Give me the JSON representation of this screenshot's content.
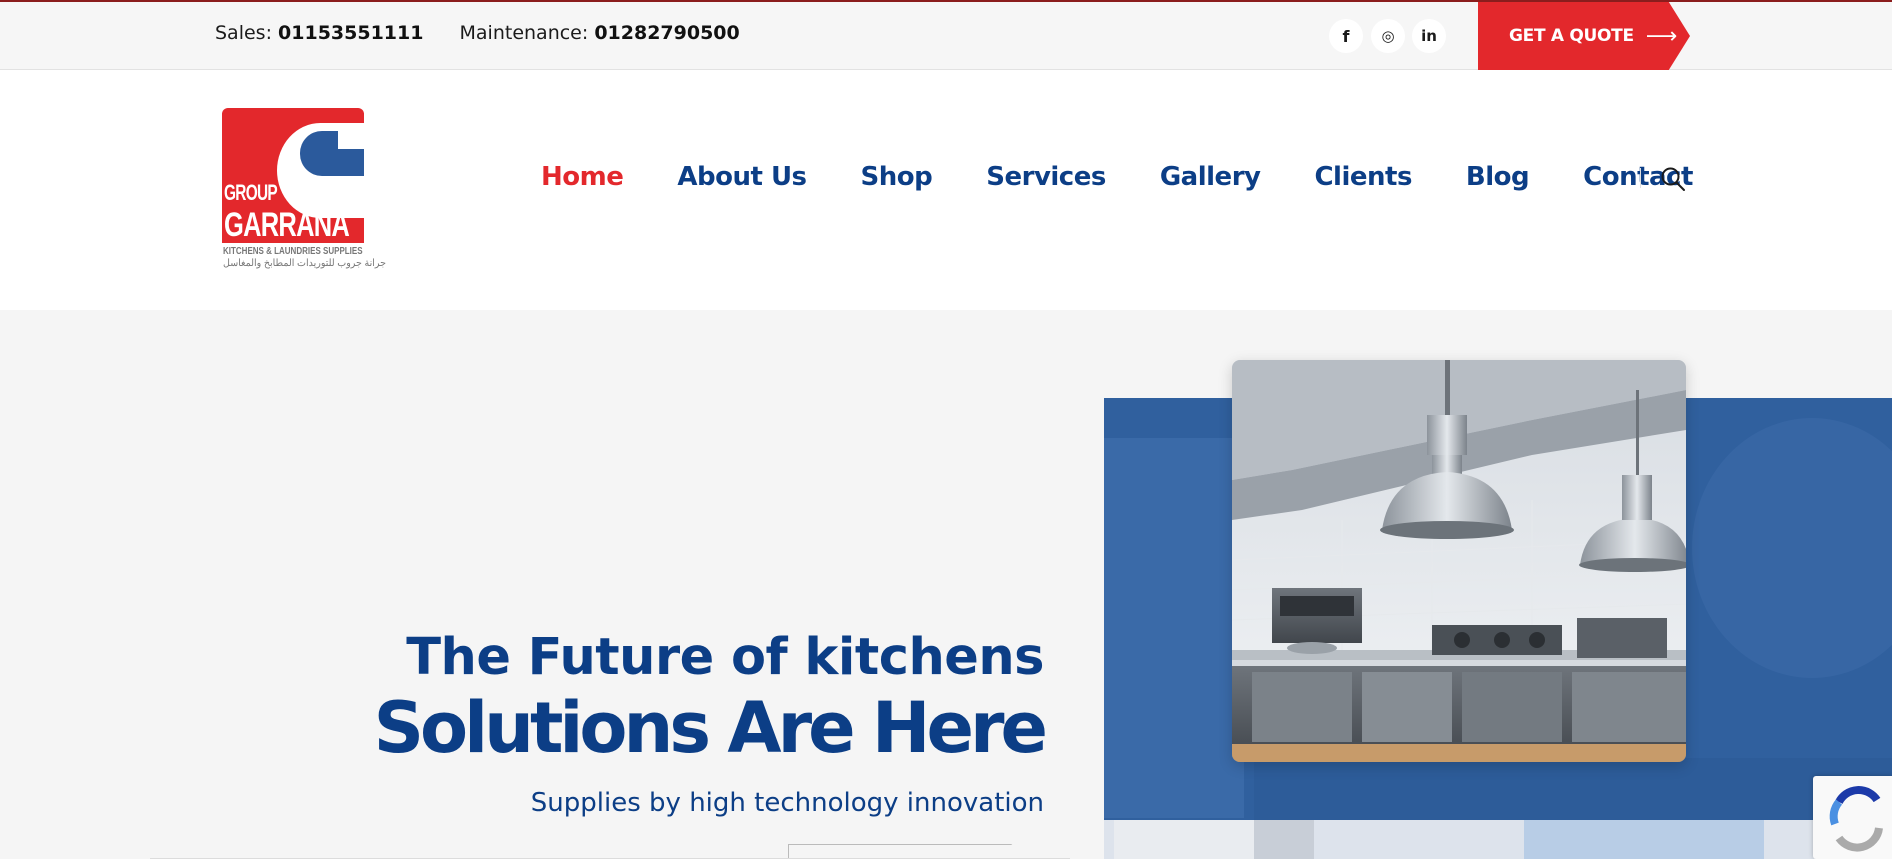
{
  "topbar": {
    "sales_label": "Sales:",
    "sales_number": "01153551111",
    "maintenance_label": "Maintenance:",
    "maintenance_number": "01282790500",
    "social": [
      {
        "icon": "facebook-icon",
        "glyph": "f"
      },
      {
        "icon": "instagram-icon",
        "glyph": "◎"
      },
      {
        "icon": "linkedin-icon",
        "glyph": "in"
      }
    ],
    "quote_label": "GET A QUOTE",
    "quote_arrow": "⟶"
  },
  "logo": {
    "word1": "GROUP",
    "word2": "GARRANA",
    "tagline_en": "KITCHENS & LAUNDRIES SUPPLIES",
    "tagline_ar": "جرانة جروب للتوريدات المطابخ والمغاسل"
  },
  "nav": {
    "items": [
      {
        "label": "Home",
        "active": true
      },
      {
        "label": "About Us"
      },
      {
        "label": "Shop"
      },
      {
        "label": "Services"
      },
      {
        "label": "Gallery"
      },
      {
        "label": "Clients"
      },
      {
        "label": "Blog"
      },
      {
        "label": "Contact"
      }
    ]
  },
  "hero": {
    "line1": "The Future of kitchens",
    "line2": "Solutions Are Here",
    "subtitle": "Supplies by high technology innovation"
  },
  "colors": {
    "brand_red": "#e3282c",
    "brand_blue": "#0c3e86",
    "panel_blue": "#30609e"
  }
}
